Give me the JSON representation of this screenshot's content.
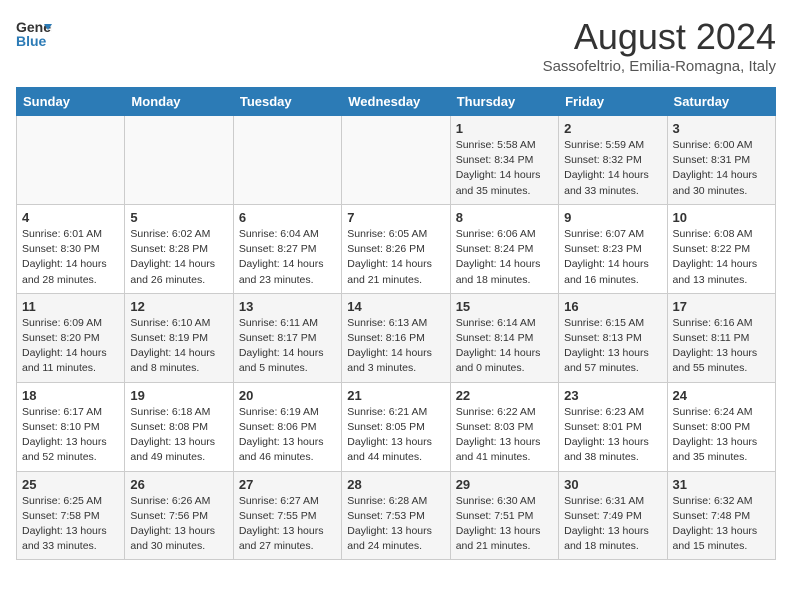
{
  "header": {
    "logo_general": "General",
    "logo_blue": "Blue",
    "title": "August 2024",
    "subtitle": "Sassofeltrio, Emilia-Romagna, Italy"
  },
  "days_of_week": [
    "Sunday",
    "Monday",
    "Tuesday",
    "Wednesday",
    "Thursday",
    "Friday",
    "Saturday"
  ],
  "weeks": [
    [
      {
        "day": "",
        "info": ""
      },
      {
        "day": "",
        "info": ""
      },
      {
        "day": "",
        "info": ""
      },
      {
        "day": "",
        "info": ""
      },
      {
        "day": "1",
        "info": "Sunrise: 5:58 AM\nSunset: 8:34 PM\nDaylight: 14 hours\nand 35 minutes."
      },
      {
        "day": "2",
        "info": "Sunrise: 5:59 AM\nSunset: 8:32 PM\nDaylight: 14 hours\nand 33 minutes."
      },
      {
        "day": "3",
        "info": "Sunrise: 6:00 AM\nSunset: 8:31 PM\nDaylight: 14 hours\nand 30 minutes."
      }
    ],
    [
      {
        "day": "4",
        "info": "Sunrise: 6:01 AM\nSunset: 8:30 PM\nDaylight: 14 hours\nand 28 minutes."
      },
      {
        "day": "5",
        "info": "Sunrise: 6:02 AM\nSunset: 8:28 PM\nDaylight: 14 hours\nand 26 minutes."
      },
      {
        "day": "6",
        "info": "Sunrise: 6:04 AM\nSunset: 8:27 PM\nDaylight: 14 hours\nand 23 minutes."
      },
      {
        "day": "7",
        "info": "Sunrise: 6:05 AM\nSunset: 8:26 PM\nDaylight: 14 hours\nand 21 minutes."
      },
      {
        "day": "8",
        "info": "Sunrise: 6:06 AM\nSunset: 8:24 PM\nDaylight: 14 hours\nand 18 minutes."
      },
      {
        "day": "9",
        "info": "Sunrise: 6:07 AM\nSunset: 8:23 PM\nDaylight: 14 hours\nand 16 minutes."
      },
      {
        "day": "10",
        "info": "Sunrise: 6:08 AM\nSunset: 8:22 PM\nDaylight: 14 hours\nand 13 minutes."
      }
    ],
    [
      {
        "day": "11",
        "info": "Sunrise: 6:09 AM\nSunset: 8:20 PM\nDaylight: 14 hours\nand 11 minutes."
      },
      {
        "day": "12",
        "info": "Sunrise: 6:10 AM\nSunset: 8:19 PM\nDaylight: 14 hours\nand 8 minutes."
      },
      {
        "day": "13",
        "info": "Sunrise: 6:11 AM\nSunset: 8:17 PM\nDaylight: 14 hours\nand 5 minutes."
      },
      {
        "day": "14",
        "info": "Sunrise: 6:13 AM\nSunset: 8:16 PM\nDaylight: 14 hours\nand 3 minutes."
      },
      {
        "day": "15",
        "info": "Sunrise: 6:14 AM\nSunset: 8:14 PM\nDaylight: 14 hours\nand 0 minutes."
      },
      {
        "day": "16",
        "info": "Sunrise: 6:15 AM\nSunset: 8:13 PM\nDaylight: 13 hours\nand 57 minutes."
      },
      {
        "day": "17",
        "info": "Sunrise: 6:16 AM\nSunset: 8:11 PM\nDaylight: 13 hours\nand 55 minutes."
      }
    ],
    [
      {
        "day": "18",
        "info": "Sunrise: 6:17 AM\nSunset: 8:10 PM\nDaylight: 13 hours\nand 52 minutes."
      },
      {
        "day": "19",
        "info": "Sunrise: 6:18 AM\nSunset: 8:08 PM\nDaylight: 13 hours\nand 49 minutes."
      },
      {
        "day": "20",
        "info": "Sunrise: 6:19 AM\nSunset: 8:06 PM\nDaylight: 13 hours\nand 46 minutes."
      },
      {
        "day": "21",
        "info": "Sunrise: 6:21 AM\nSunset: 8:05 PM\nDaylight: 13 hours\nand 44 minutes."
      },
      {
        "day": "22",
        "info": "Sunrise: 6:22 AM\nSunset: 8:03 PM\nDaylight: 13 hours\nand 41 minutes."
      },
      {
        "day": "23",
        "info": "Sunrise: 6:23 AM\nSunset: 8:01 PM\nDaylight: 13 hours\nand 38 minutes."
      },
      {
        "day": "24",
        "info": "Sunrise: 6:24 AM\nSunset: 8:00 PM\nDaylight: 13 hours\nand 35 minutes."
      }
    ],
    [
      {
        "day": "25",
        "info": "Sunrise: 6:25 AM\nSunset: 7:58 PM\nDaylight: 13 hours\nand 33 minutes."
      },
      {
        "day": "26",
        "info": "Sunrise: 6:26 AM\nSunset: 7:56 PM\nDaylight: 13 hours\nand 30 minutes."
      },
      {
        "day": "27",
        "info": "Sunrise: 6:27 AM\nSunset: 7:55 PM\nDaylight: 13 hours\nand 27 minutes."
      },
      {
        "day": "28",
        "info": "Sunrise: 6:28 AM\nSunset: 7:53 PM\nDaylight: 13 hours\nand 24 minutes."
      },
      {
        "day": "29",
        "info": "Sunrise: 6:30 AM\nSunset: 7:51 PM\nDaylight: 13 hours\nand 21 minutes."
      },
      {
        "day": "30",
        "info": "Sunrise: 6:31 AM\nSunset: 7:49 PM\nDaylight: 13 hours\nand 18 minutes."
      },
      {
        "day": "31",
        "info": "Sunrise: 6:32 AM\nSunset: 7:48 PM\nDaylight: 13 hours\nand 15 minutes."
      }
    ]
  ]
}
